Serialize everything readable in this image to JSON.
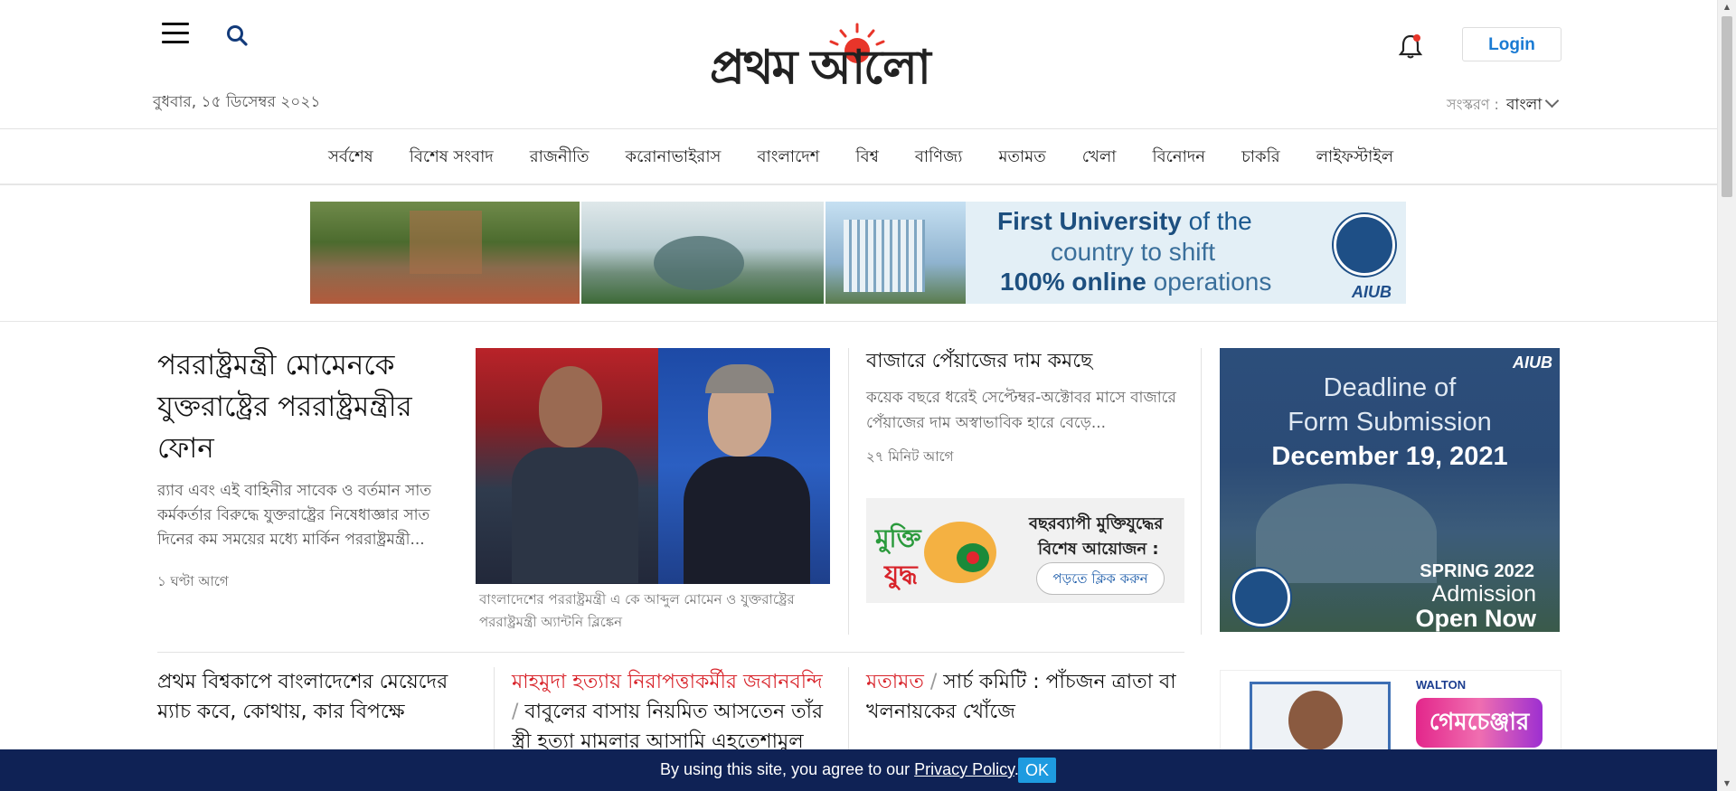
{
  "header": {
    "date": "বুধবার, ১৫ ডিসেম্বর ২০২১",
    "logo_text": "প্রথম আলো",
    "login_label": "Login",
    "edition_label": "সংস্করণ :",
    "edition_value": "বাংলা"
  },
  "nav": {
    "items": [
      "সর্বশেষ",
      "বিশেষ সংবাদ",
      "রাজনীতি",
      "করোনাভাইরাস",
      "বাংলাদেশ",
      "বিশ্ব",
      "বাণিজ্য",
      "মতামত",
      "খেলা",
      "বিনোদন",
      "চাকরি",
      "লাইফস্টাইল"
    ]
  },
  "top_banner": {
    "line1_bold": "First University",
    "line1_rest": " of the",
    "line2": "country to shift",
    "line3_bold": "100% online",
    "line3_rest": " operations",
    "brand": "AIUB"
  },
  "lead": {
    "title": "পররাষ্ট্রমন্ত্রী মোমেনকে যুক্তরাষ্ট্রের পররাষ্ট্রমন্ত্রীর ফোন",
    "summary": "র‍্যাব এবং এই বাহিনীর সাবেক ও বর্তমান সাত কর্মকর্তার বিরুদ্ধে যুক্তরাষ্ট্রের নিষেধাজ্ঞার সাত দিনের কম সময়ের মধ্যে মার্কিন পররাষ্ট্রমন্ত্রী...",
    "time": "১ ঘণ্টা আগে",
    "caption": "বাংলাদেশের পররাষ্ট্রমন্ত্রী এ কে আব্দুল মোমেন ও যুক্তরাষ্ট্রের পররাষ্ট্রমন্ত্রী অ্যান্টনি ব্লিঙ্কেন"
  },
  "side_story": {
    "title": "বাজারে পেঁয়াজের দাম কমছে",
    "summary": "কয়েক বছরে ধরেই সেপ্টেম্বর-অক্টোবর মাসে বাজারে পেঁয়াজের দাম অস্বাভাবিক হারে বেড়ে...",
    "time": "২৭ মিনিট আগে"
  },
  "mukti_banner": {
    "logo_text": "মুক্তিযুদ্ধ",
    "line1": "বছরব্যাপী মুক্তিযুদ্ধের",
    "line2": "বিশেষ আয়োজন :",
    "button": "পড়তে ক্লিক করুন"
  },
  "right_ad": {
    "brand": "AIUB",
    "line1": "Deadline of",
    "line2": "Form Submission",
    "line3": "December 19, 2021",
    "line4": "SPRING 2022",
    "line5": "Admission",
    "line6": "Open Now"
  },
  "right_ad2": {
    "brand": "WALTON",
    "game": "গেমচেঞ্জার"
  },
  "row2": [
    {
      "title": "প্রথম বিশ্বকাপে বাংলাদেশের মেয়েদের ম্যাচ কবে, কোথায়, কার বিপক্ষে"
    },
    {
      "kicker": "মাহমুদা হত্যায় নিরাপত্তাকর্মীর জবানবন্দি",
      "title": "বাবুলের বাসায় নিয়মিত আসতেন তাঁর স্ত্রী হত্যা মামলার আসামি এহতেশামুল"
    },
    {
      "kicker": "মতামত",
      "title": "সার্চ কমিটি : পাঁচজন ত্রাতা বা খলনায়কের খোঁজে"
    }
  ],
  "cookie": {
    "text_before": "By using this site, you agree to our ",
    "link": "Privacy Policy",
    "text_after": ".",
    "ok": "OK"
  }
}
